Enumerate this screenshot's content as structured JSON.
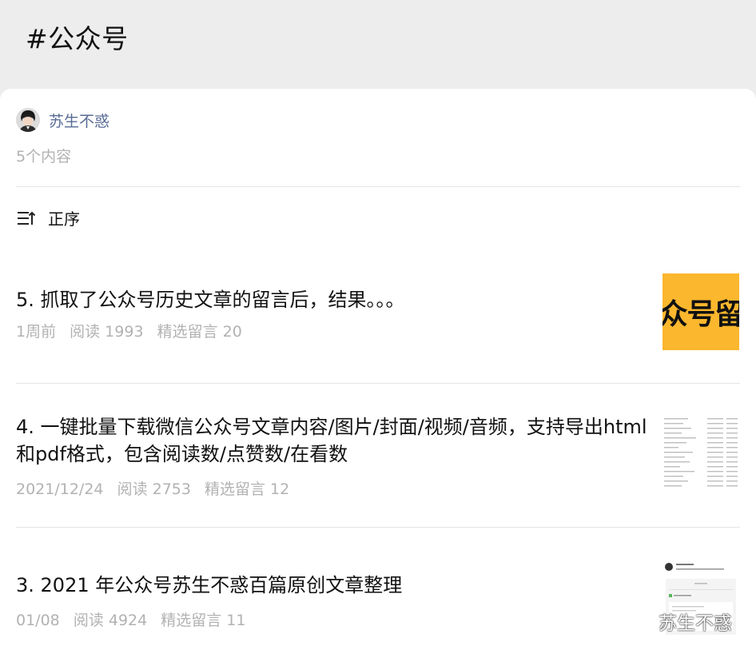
{
  "header": {
    "title": "#公众号"
  },
  "author": {
    "name": "苏生不惑",
    "count_label": "5个内容"
  },
  "sort": {
    "label": "正序",
    "icon": "sort-icon"
  },
  "articles": [
    {
      "title": "5. 抓取了公众号历史文章的留言后，结果。。。",
      "date": "1周前",
      "reads": "阅读 1993",
      "comments": "精选留言 20",
      "thumb_text": "众号留",
      "thumb_color": "#fbb72d"
    },
    {
      "title": "4. 一键批量下载微信公众号文章内容/图片/封面/视频/音频，支持导出html和pdf格式，包含阅读数/点赞数/在看数",
      "date": "2021/12/24",
      "reads": "阅读 2753",
      "comments": "精选留言 12"
    },
    {
      "title": "3. 2021 年公众号苏生不惑百篇原创文章整理",
      "date": "01/08",
      "reads": "阅读 4924",
      "comments": "精选留言 11"
    }
  ],
  "watermark": {
    "text": "苏生不惑",
    "icon": "wechat-icon"
  }
}
